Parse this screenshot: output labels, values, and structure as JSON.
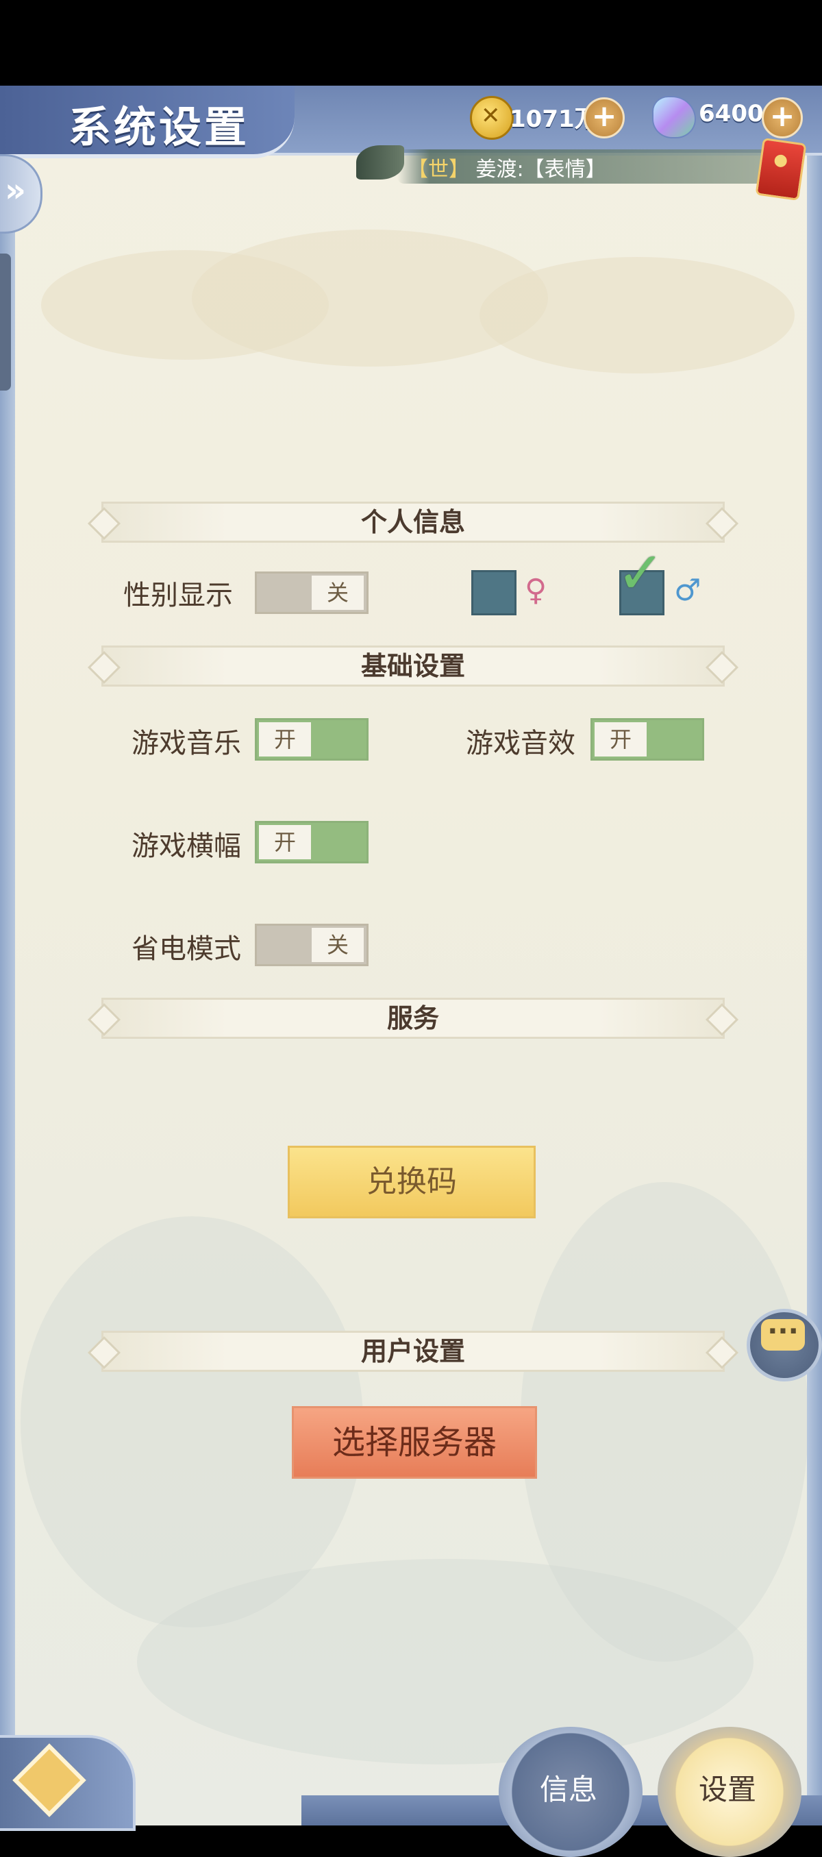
{
  "header": {
    "title": "系统设置",
    "coins": "1071万",
    "gems": "6400",
    "plus": "+"
  },
  "chat": {
    "channel": "【世】",
    "message": "姜渡:【表情】"
  },
  "sections": {
    "personal": "个人信息",
    "basic": "基础设置",
    "service": "服务",
    "user": "用户设置"
  },
  "settings": {
    "gender_display": {
      "label": "性别显示",
      "state": "关"
    },
    "game_music": {
      "label": "游戏音乐",
      "state": "开"
    },
    "game_sfx": {
      "label": "游戏音效",
      "state": "开"
    },
    "game_banner": {
      "label": "游戏横幅",
      "state": "开"
    },
    "power_saving": {
      "label": "省电模式",
      "state": "关"
    }
  },
  "gender": {
    "female_symbol": "♀",
    "male_symbol": "♂",
    "selected": "male"
  },
  "buttons": {
    "redeem": "兑换码",
    "select_server": "选择服务器"
  },
  "nav": {
    "info": "信息",
    "settings": "设置"
  },
  "colors": {
    "toggle_on": "#94bc80",
    "toggle_off": "#c9c3b6",
    "redeem_button": "#f2c95e",
    "server_button": "#e77d58"
  }
}
